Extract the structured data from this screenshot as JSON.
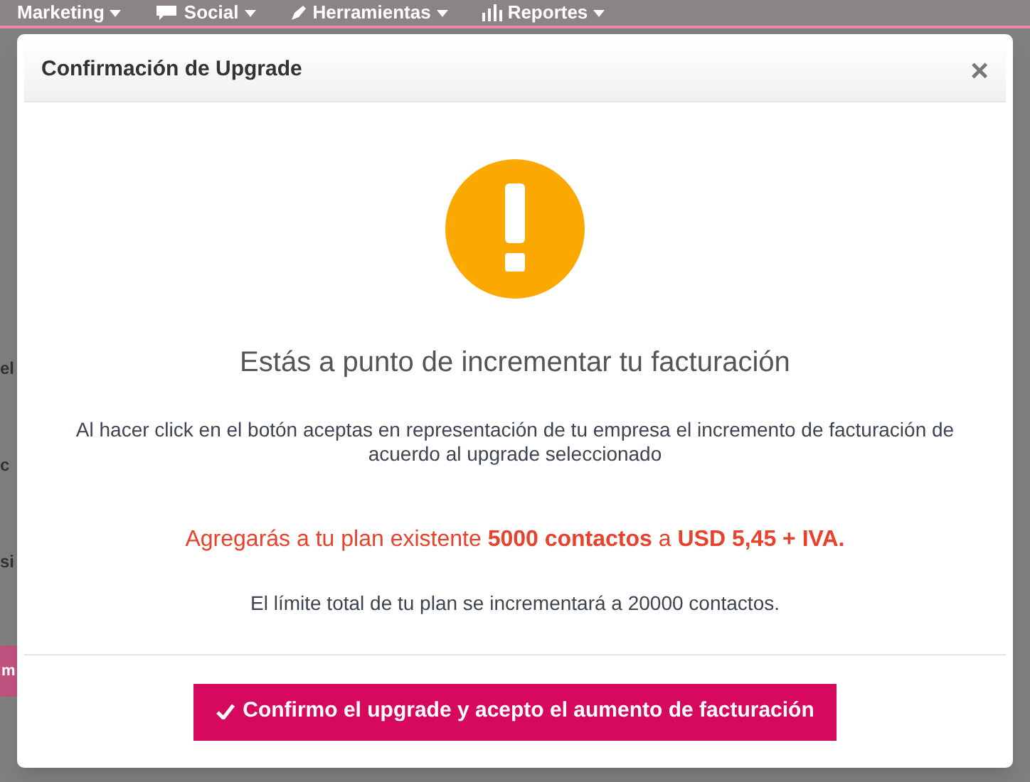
{
  "nav": {
    "items": [
      {
        "label": "Marketing"
      },
      {
        "label": "Social"
      },
      {
        "label": "Herramientas"
      },
      {
        "label": "Reportes"
      }
    ]
  },
  "background": {
    "fragments": [
      {
        "kind": "text",
        "text": "el"
      },
      {
        "kind": "text",
        "text": "c"
      },
      {
        "kind": "text",
        "text": "si"
      },
      {
        "kind": "button",
        "text": "m"
      }
    ]
  },
  "dialog": {
    "title": "Confirmación de Upgrade",
    "close": "×",
    "heading": "Estás a punto de incrementar tu facturación",
    "body": "Al hacer click en el botón aceptas en representación de tu empresa el incremento de facturación de acuerdo al upgrade seleccionado",
    "offer": "Agregarás a tu plan existente **5000 contactos** a **USD 5,45 + IVA.**",
    "limit": "El límite total de tu plan se incrementará a 20000 contactos.",
    "confirm_button": "Confirmo el upgrade y acepto el aumento de facturación"
  }
}
